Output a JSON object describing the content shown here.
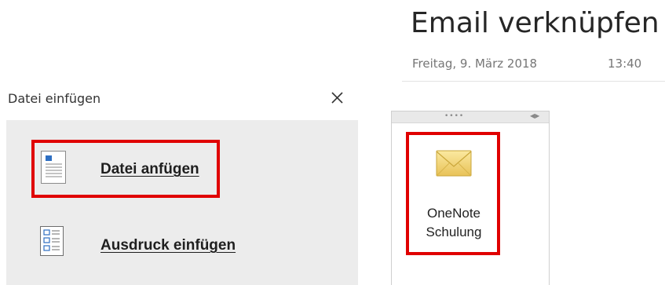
{
  "page": {
    "title": "Email verknüpfen",
    "date": "Freitag, 9. März 2018",
    "time": "13:40"
  },
  "dialog": {
    "title": "Datei einfügen",
    "close_icon": "close-icon",
    "options": [
      {
        "label": "Datei anfügen",
        "icon": "attach-file-icon",
        "highlighted": true
      },
      {
        "label": "Ausdruck einfügen",
        "icon": "insert-printout-icon",
        "highlighted": false
      }
    ]
  },
  "note_container": {
    "attachment": {
      "icon": "email-envelope-icon",
      "name_line1": "OneNote",
      "name_line2": "Schulung",
      "highlighted": true
    }
  },
  "colors": {
    "highlight": "#e00000",
    "panel": "#ececec"
  }
}
